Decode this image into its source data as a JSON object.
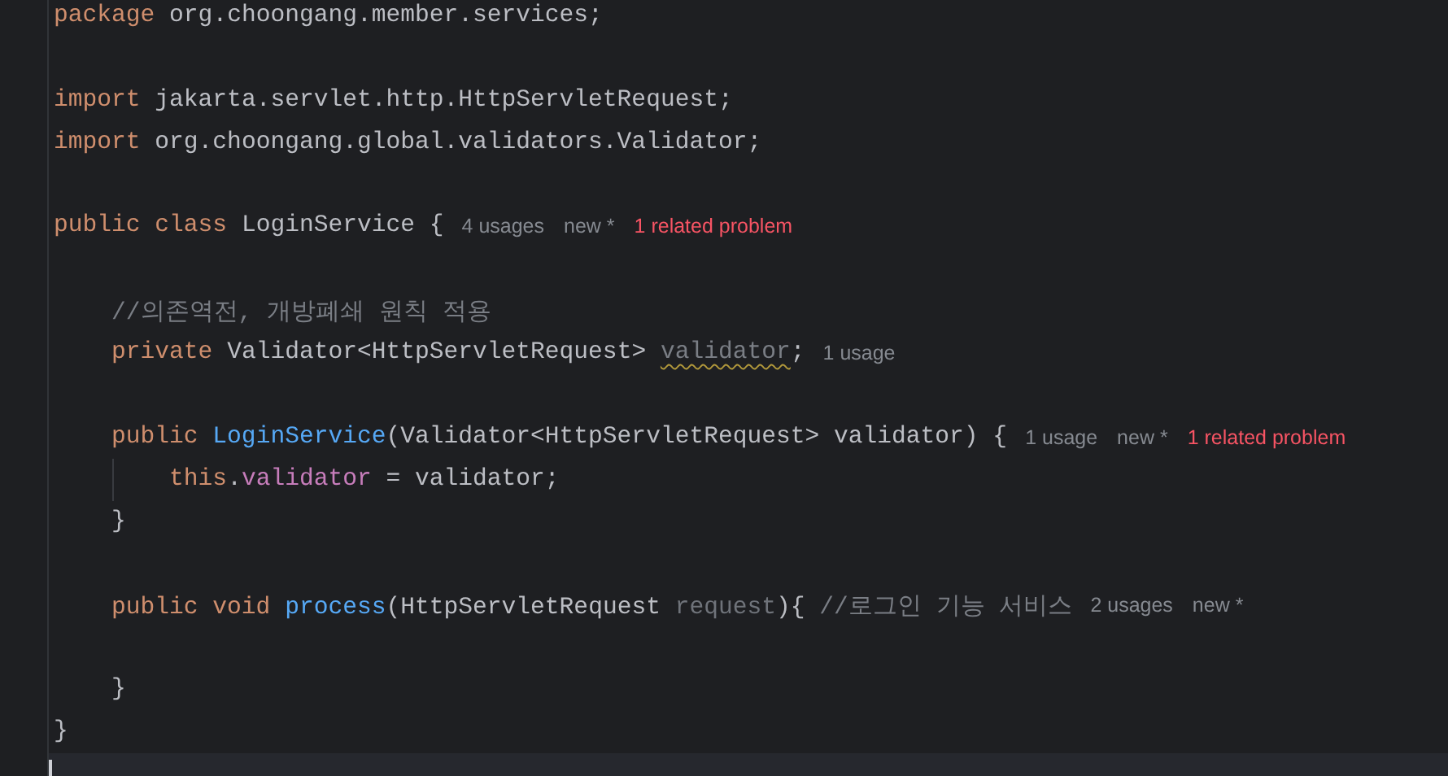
{
  "lines": [
    {
      "tokens": [
        {
          "text": "package",
          "kind": "keyword"
        },
        {
          "text": " org.choongang.member.services;",
          "kind": "plain"
        }
      ]
    },
    {
      "kind": "blank"
    },
    {
      "tokens": [
        {
          "text": "import",
          "kind": "keyword"
        },
        {
          "text": " jakarta.servlet.http.HttpServletRequest;",
          "kind": "plain"
        }
      ]
    },
    {
      "tokens": [
        {
          "text": "import",
          "kind": "keyword"
        },
        {
          "text": " org.choongang.global.validators.Validator;",
          "kind": "plain"
        }
      ]
    },
    {
      "kind": "blank"
    },
    {
      "tokens": [
        {
          "text": "public class",
          "kind": "keyword"
        },
        {
          "text": " LoginService {",
          "kind": "plain"
        }
      ],
      "hints": [
        {
          "text": "4 usages",
          "kind": "usage"
        },
        {
          "text": "new *",
          "kind": "author"
        },
        {
          "text": "1 related problem",
          "kind": "problem"
        }
      ],
      "children": [
        {
          "kind": "blank"
        },
        {
          "tokens": [
            {
              "text": "//의존역전, 개방폐쇄 원칙 적용",
              "kind": "comment"
            }
          ]
        },
        {
          "tokens": [
            {
              "text": "private",
              "kind": "keyword"
            },
            {
              "text": " Validator<HttpServletRequest> ",
              "kind": "plain"
            },
            {
              "text": "validator",
              "kind": "warning"
            },
            {
              "text": ";",
              "kind": "plain"
            }
          ],
          "hints": [
            {
              "text": "1 usage",
              "kind": "usage"
            }
          ]
        },
        {
          "kind": "blank"
        },
        {
          "tokens": [
            {
              "text": "public",
              "kind": "keyword"
            },
            {
              "text": " LoginService",
              "kind": "method"
            },
            {
              "text": "(Validator<HttpServletRequest> validator) {",
              "kind": "plain"
            }
          ],
          "hints": [
            {
              "text": "1 usage",
              "kind": "usage"
            },
            {
              "text": "new *",
              "kind": "author"
            },
            {
              "text": "1 related problem",
              "kind": "problem"
            }
          ],
          "children": [
            {
              "tokens": [
                {
                  "text": "this",
                  "kind": "keyword"
                },
                {
                  "text": ".",
                  "kind": "plain"
                },
                {
                  "text": "validator",
                  "kind": "field"
                },
                {
                  "text": " = validator;",
                  "kind": "plain"
                }
              ]
            }
          ]
        },
        {
          "tokens": [
            {
              "text": "}",
              "kind": "plain"
            }
          ]
        },
        {
          "kind": "blank"
        },
        {
          "tokens": [
            {
              "text": "public void",
              "kind": "keyword"
            },
            {
              "text": " process",
              "kind": "method"
            },
            {
              "text": "(HttpServletRequest ",
              "kind": "plain"
            },
            {
              "text": "request",
              "kind": "unused"
            },
            {
              "text": "){ ",
              "kind": "plain"
            },
            {
              "text": "//로그인 기능 서비스",
              "kind": "comment"
            }
          ],
          "hints": [
            {
              "text": "2 usages",
              "kind": "usage"
            },
            {
              "text": "new *",
              "kind": "author"
            }
          ],
          "children": [
            {
              "kind": "blank"
            }
          ]
        },
        {
          "tokens": [
            {
              "text": "}",
              "kind": "plain"
            }
          ]
        }
      ]
    },
    {
      "tokens": [
        {
          "text": "}",
          "kind": "plain"
        }
      ]
    },
    {
      "kind": "current"
    }
  ]
}
